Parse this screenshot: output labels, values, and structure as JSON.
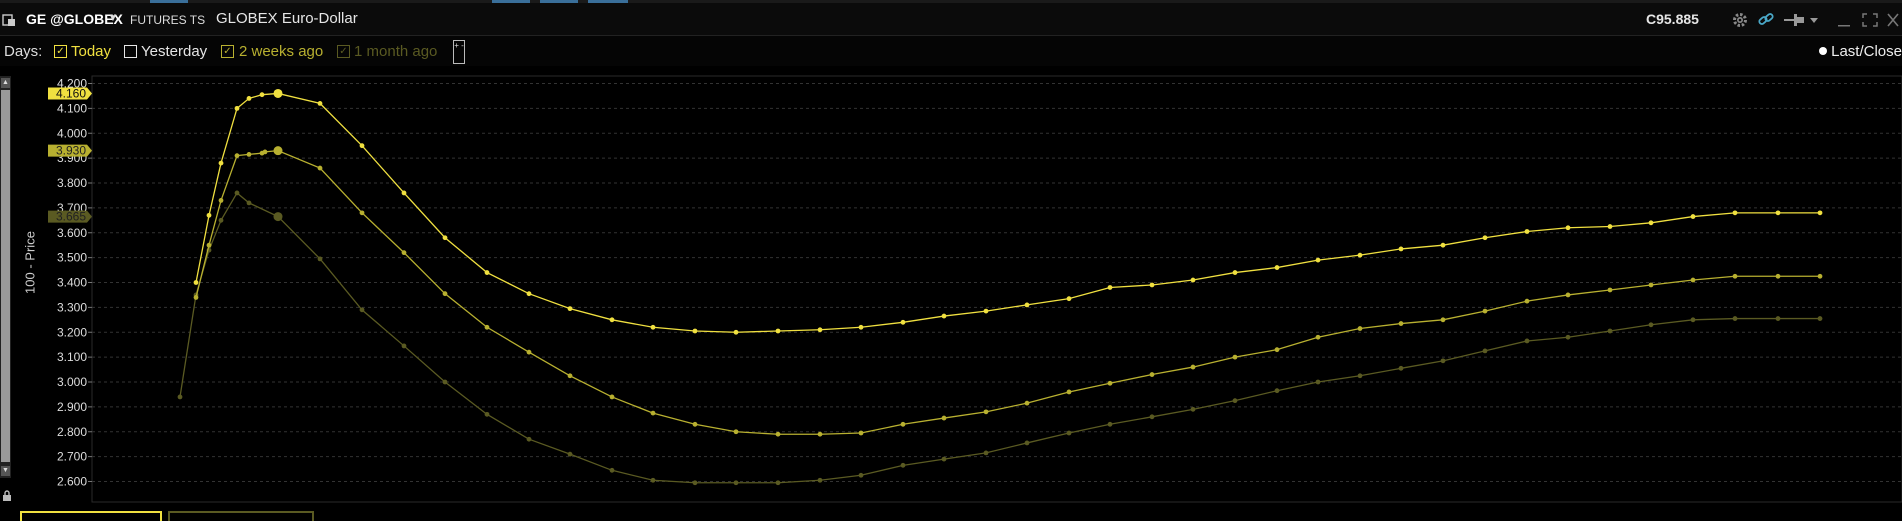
{
  "window": {
    "symbol": "GE @GLOBEX",
    "subtitle": "FUTURES TS",
    "description": "GLOBEX Euro-Dollar",
    "last_price": "C95.885"
  },
  "toolbar_icons": [
    "gear-icon",
    "link-icon",
    "pin-icon",
    "chevron-down-icon",
    "minimize-icon",
    "maximize-icon",
    "close-icon"
  ],
  "days": {
    "label": "Days:",
    "options": [
      {
        "label": "Today",
        "checked": true,
        "color": "#f0e040"
      },
      {
        "label": "Yesterday",
        "checked": false,
        "color": "#e6e6e6"
      },
      {
        "label": "2 weeks ago",
        "checked": true,
        "color": "#b8b030"
      },
      {
        "label": "1 month ago",
        "checked": true,
        "color": "#5a5a22"
      }
    ],
    "plus_minus": "+ -"
  },
  "legend": {
    "label": "Last/Close"
  },
  "chart_data": {
    "type": "line",
    "ylabel": "100 - Price",
    "ylim": [
      2.55,
      4.22
    ],
    "yticks": [
      "4.200",
      "4.100",
      "4.000",
      "3.900",
      "3.800",
      "3.700",
      "3.600",
      "3.500",
      "3.400",
      "3.300",
      "3.200",
      "3.100",
      "3.000",
      "2.900",
      "2.800",
      "2.700",
      "2.600"
    ],
    "grid": true,
    "markers": [
      {
        "label": "4.160",
        "value": 4.16,
        "color": "#f0e040"
      },
      {
        "label": "3.930",
        "value": 3.93,
        "color": "#b8b030"
      },
      {
        "label": "3.665",
        "value": 3.665,
        "color": "#5a5a22"
      }
    ],
    "series": [
      {
        "name": "Today",
        "color": "#f0e040",
        "highlight_index": 6,
        "x": [
          196,
          209,
          221,
          237,
          249,
          262,
          278,
          320,
          362,
          404,
          445,
          487,
          529,
          570,
          612,
          653,
          695,
          736,
          778,
          820,
          861,
          903,
          944,
          986,
          1027,
          1069,
          1110,
          1152,
          1193,
          1235,
          1277,
          1318,
          1360,
          1401,
          1443,
          1485,
          1527,
          1568,
          1610,
          1651,
          1693,
          1735,
          1778,
          1820
        ],
        "values": [
          3.4,
          3.67,
          3.88,
          4.1,
          4.14,
          4.155,
          4.16,
          4.12,
          3.95,
          3.76,
          3.58,
          3.44,
          3.355,
          3.295,
          3.25,
          3.22,
          3.205,
          3.2,
          3.205,
          3.21,
          3.22,
          3.24,
          3.265,
          3.285,
          3.31,
          3.335,
          3.38,
          3.39,
          3.41,
          3.44,
          3.46,
          3.49,
          3.51,
          3.535,
          3.55,
          3.58,
          3.605,
          3.62,
          3.625,
          3.64,
          3.665,
          3.68,
          3.68,
          3.68
        ]
      },
      {
        "name": "2 weeks ago",
        "color": "#b8b030",
        "highlight_index": 7,
        "x": [
          196,
          209,
          221,
          237,
          249,
          262,
          265,
          278,
          320,
          362,
          404,
          445,
          487,
          529,
          570,
          612,
          653,
          695,
          736,
          778,
          820,
          861,
          903,
          944,
          986,
          1027,
          1069,
          1110,
          1152,
          1193,
          1235,
          1277,
          1318,
          1360,
          1401,
          1443,
          1485,
          1527,
          1568,
          1610,
          1651,
          1693,
          1735,
          1778,
          1820
        ],
        "values": [
          3.34,
          3.55,
          3.73,
          3.91,
          3.915,
          3.92,
          3.925,
          3.93,
          3.86,
          3.68,
          3.52,
          3.355,
          3.22,
          3.12,
          3.025,
          2.94,
          2.875,
          2.83,
          2.8,
          2.79,
          2.79,
          2.795,
          2.83,
          2.855,
          2.88,
          2.915,
          2.96,
          2.995,
          3.03,
          3.06,
          3.1,
          3.13,
          3.18,
          3.215,
          3.235,
          3.25,
          3.285,
          3.325,
          3.35,
          3.37,
          3.39,
          3.41,
          3.425,
          3.425,
          3.425
        ]
      },
      {
        "name": "1 month ago",
        "color": "#5a5a22",
        "highlight_index": 6,
        "x": [
          180,
          196,
          209,
          221,
          237,
          249,
          278,
          320,
          362,
          404,
          445,
          487,
          529,
          570,
          612,
          653,
          695,
          736,
          778,
          820,
          861,
          903,
          944,
          986,
          1027,
          1069,
          1110,
          1152,
          1193,
          1235,
          1277,
          1318,
          1360,
          1401,
          1443,
          1485,
          1527,
          1568,
          1610,
          1651,
          1693,
          1735,
          1778,
          1820
        ],
        "values": [
          2.94,
          3.35,
          3.53,
          3.65,
          3.76,
          3.72,
          3.665,
          3.495,
          3.29,
          3.145,
          3.0,
          2.87,
          2.77,
          2.71,
          2.645,
          2.605,
          2.595,
          2.595,
          2.595,
          2.605,
          2.625,
          2.665,
          2.69,
          2.715,
          2.755,
          2.795,
          2.83,
          2.86,
          2.89,
          2.925,
          2.965,
          3.0,
          3.025,
          3.055,
          3.085,
          3.125,
          3.165,
          3.18,
          3.205,
          3.23,
          3.25,
          3.255,
          3.255,
          3.255
        ]
      }
    ]
  },
  "bottom_tabs": [
    {
      "color": "#f0e040"
    },
    {
      "color": "#5a5a22"
    }
  ]
}
